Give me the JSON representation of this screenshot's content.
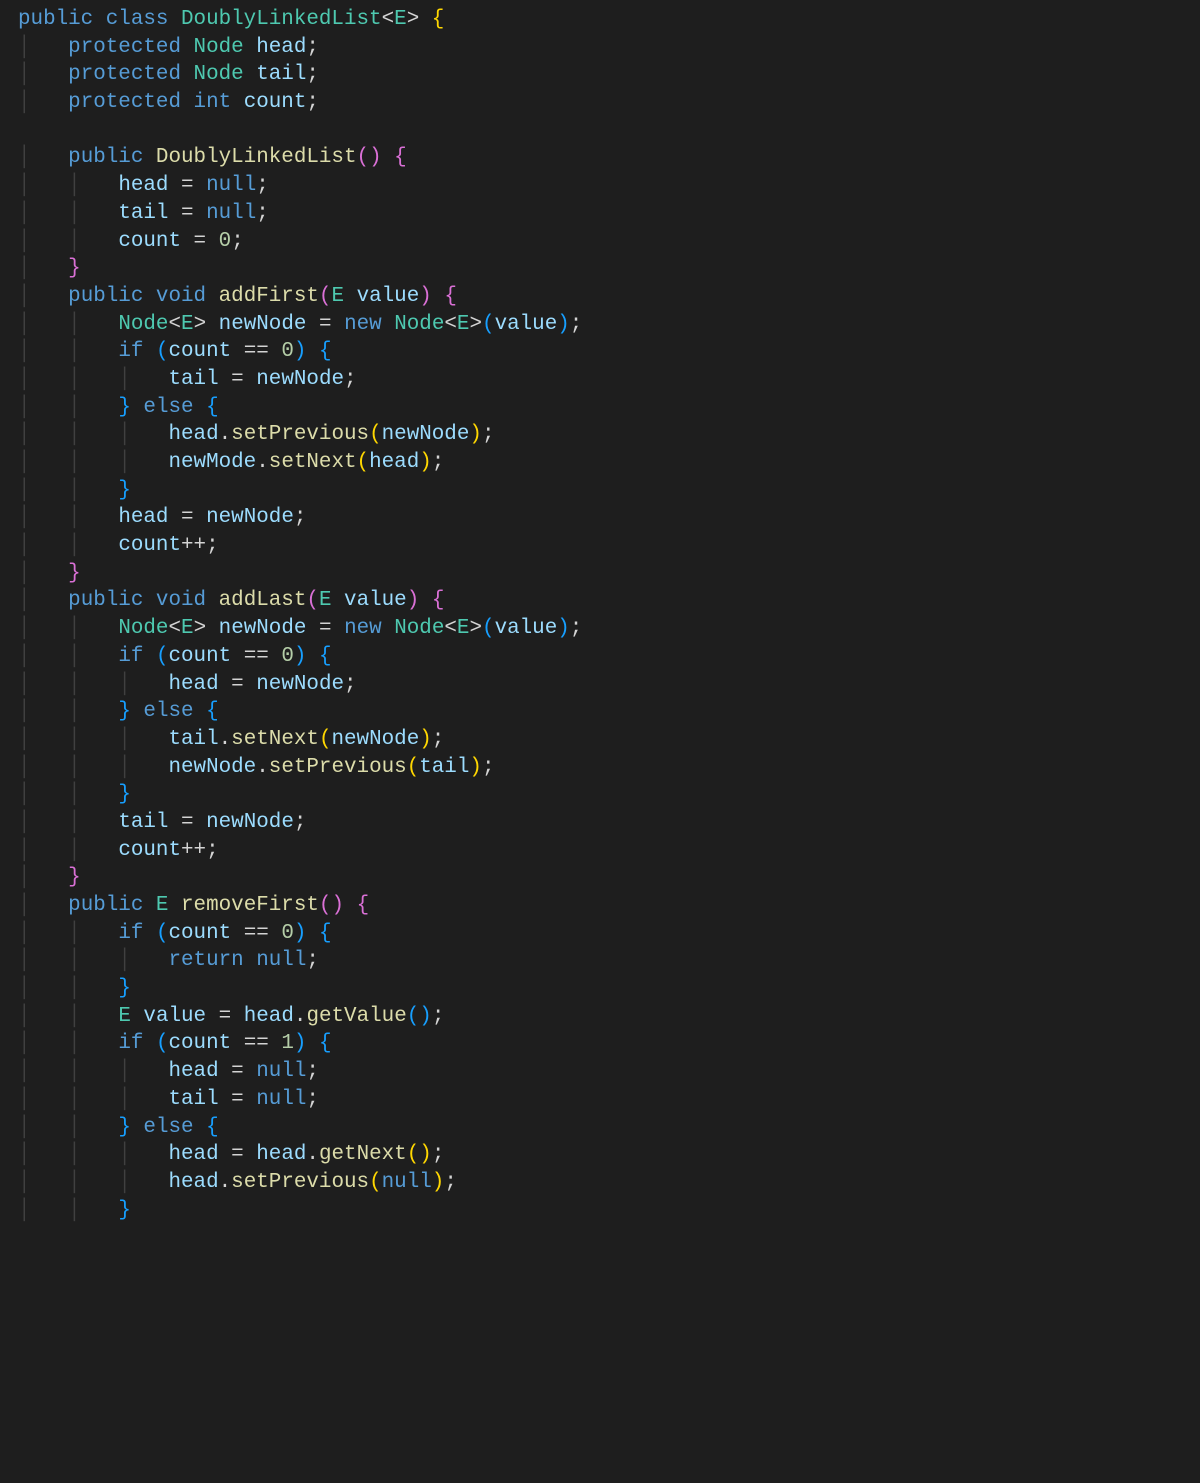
{
  "code": {
    "tokens": [
      [
        [
          "kw",
          "public"
        ],
        [
          "",
          ""
        ],
        [
          "kw",
          "class"
        ],
        [
          "",
          ""
        ],
        [
          "type",
          "DoublyLinkedList"
        ],
        [
          "op",
          "<"
        ],
        [
          "typeparam",
          "E"
        ],
        [
          "op",
          ">"
        ],
        [
          "",
          ""
        ],
        [
          "brace",
          "{"
        ]
      ],
      [
        [
          "",
          "    "
        ],
        [
          "kw",
          "protected"
        ],
        [
          "",
          ""
        ],
        [
          "type",
          "Node"
        ],
        [
          "",
          ""
        ],
        [
          "field",
          "head"
        ],
        [
          "punc",
          ";"
        ]
      ],
      [
        [
          "",
          "    "
        ],
        [
          "kw",
          "protected"
        ],
        [
          "",
          ""
        ],
        [
          "type",
          "Node"
        ],
        [
          "",
          ""
        ],
        [
          "field",
          "tail"
        ],
        [
          "punc",
          ";"
        ]
      ],
      [
        [
          "",
          "    "
        ],
        [
          "kw",
          "protected"
        ],
        [
          "",
          ""
        ],
        [
          "kw",
          "int"
        ],
        [
          "",
          ""
        ],
        [
          "field",
          "count"
        ],
        [
          "punc",
          ";"
        ]
      ],
      [
        [
          "",
          ""
        ]
      ],
      [
        [
          "",
          "    "
        ],
        [
          "kw",
          "public"
        ],
        [
          "",
          ""
        ],
        [
          "fn",
          "DoublyLinkedList"
        ],
        [
          "paren2",
          "("
        ],
        [
          "paren2",
          ")"
        ],
        [
          "",
          ""
        ],
        [
          "brace2",
          "{"
        ]
      ],
      [
        [
          "",
          "        "
        ],
        [
          "field",
          "head"
        ],
        [
          "",
          ""
        ],
        [
          "op",
          "="
        ],
        [
          "",
          ""
        ],
        [
          "kw",
          "null"
        ],
        [
          "punc",
          ";"
        ]
      ],
      [
        [
          "",
          "        "
        ],
        [
          "field",
          "tail"
        ],
        [
          "",
          ""
        ],
        [
          "op",
          "="
        ],
        [
          "",
          ""
        ],
        [
          "kw",
          "null"
        ],
        [
          "punc",
          ";"
        ]
      ],
      [
        [
          "",
          "        "
        ],
        [
          "field",
          "count"
        ],
        [
          "",
          ""
        ],
        [
          "op",
          "="
        ],
        [
          "",
          ""
        ],
        [
          "num",
          "0"
        ],
        [
          "punc",
          ";"
        ]
      ],
      [
        [
          "",
          "    "
        ],
        [
          "brace2",
          "}"
        ]
      ],
      [
        [
          "",
          "    "
        ],
        [
          "kw",
          "public"
        ],
        [
          "",
          ""
        ],
        [
          "kw",
          "void"
        ],
        [
          "",
          ""
        ],
        [
          "fn",
          "addFirst"
        ],
        [
          "paren2",
          "("
        ],
        [
          "type",
          "E"
        ],
        [
          "",
          ""
        ],
        [
          "var",
          "value"
        ],
        [
          "paren2",
          ")"
        ],
        [
          "",
          ""
        ],
        [
          "brace2",
          "{"
        ]
      ],
      [
        [
          "",
          "        "
        ],
        [
          "type",
          "Node"
        ],
        [
          "op",
          "<"
        ],
        [
          "type",
          "E"
        ],
        [
          "op",
          ">"
        ],
        [
          "",
          ""
        ],
        [
          "var",
          "newNode"
        ],
        [
          "",
          ""
        ],
        [
          "op",
          "="
        ],
        [
          "",
          ""
        ],
        [
          "kw",
          "new"
        ],
        [
          "",
          ""
        ],
        [
          "type",
          "Node"
        ],
        [
          "op",
          "<"
        ],
        [
          "type",
          "E"
        ],
        [
          "op",
          ">"
        ],
        [
          "paren3",
          "("
        ],
        [
          "var",
          "value"
        ],
        [
          "paren3",
          ")"
        ],
        [
          "punc",
          ";"
        ]
      ],
      [
        [
          "",
          "        "
        ],
        [
          "kw",
          "if"
        ],
        [
          "",
          ""
        ],
        [
          "paren3",
          "("
        ],
        [
          "field",
          "count"
        ],
        [
          "",
          ""
        ],
        [
          "op",
          "=="
        ],
        [
          "",
          ""
        ],
        [
          "num",
          "0"
        ],
        [
          "paren3",
          ")"
        ],
        [
          "",
          ""
        ],
        [
          "brace3",
          "{"
        ]
      ],
      [
        [
          "",
          "            "
        ],
        [
          "field",
          "tail"
        ],
        [
          "",
          ""
        ],
        [
          "op",
          "="
        ],
        [
          "",
          ""
        ],
        [
          "var",
          "newNode"
        ],
        [
          "punc",
          ";"
        ]
      ],
      [
        [
          "",
          "        "
        ],
        [
          "brace3",
          "}"
        ],
        [
          "",
          ""
        ],
        [
          "kw",
          "else"
        ],
        [
          "",
          ""
        ],
        [
          "brace3",
          "{"
        ]
      ],
      [
        [
          "",
          "            "
        ],
        [
          "field",
          "head"
        ],
        [
          "punc",
          "."
        ],
        [
          "fn",
          "setPrevious"
        ],
        [
          "paren",
          "("
        ],
        [
          "var",
          "newNode"
        ],
        [
          "paren",
          ")"
        ],
        [
          "punc",
          ";"
        ]
      ],
      [
        [
          "",
          "            "
        ],
        [
          "var",
          "newMode"
        ],
        [
          "punc",
          "."
        ],
        [
          "fn",
          "setNext"
        ],
        [
          "paren",
          "("
        ],
        [
          "field",
          "head"
        ],
        [
          "paren",
          ")"
        ],
        [
          "punc",
          ";"
        ]
      ],
      [
        [
          "",
          "        "
        ],
        [
          "brace3",
          "}"
        ]
      ],
      [
        [
          "",
          "        "
        ],
        [
          "field",
          "head"
        ],
        [
          "",
          ""
        ],
        [
          "op",
          "="
        ],
        [
          "",
          ""
        ],
        [
          "var",
          "newNode"
        ],
        [
          "punc",
          ";"
        ]
      ],
      [
        [
          "",
          "        "
        ],
        [
          "field",
          "count"
        ],
        [
          "op",
          "++"
        ],
        [
          "punc",
          ";"
        ]
      ],
      [
        [
          "",
          "    "
        ],
        [
          "brace2",
          "}"
        ]
      ],
      [
        [
          "",
          "    "
        ],
        [
          "kw",
          "public"
        ],
        [
          "",
          ""
        ],
        [
          "kw",
          "void"
        ],
        [
          "",
          ""
        ],
        [
          "fn",
          "addLast"
        ],
        [
          "paren2",
          "("
        ],
        [
          "type",
          "E"
        ],
        [
          "",
          ""
        ],
        [
          "var",
          "value"
        ],
        [
          "paren2",
          ")"
        ],
        [
          "",
          ""
        ],
        [
          "brace2",
          "{"
        ]
      ],
      [
        [
          "",
          "        "
        ],
        [
          "type",
          "Node"
        ],
        [
          "op",
          "<"
        ],
        [
          "type",
          "E"
        ],
        [
          "op",
          ">"
        ],
        [
          "",
          ""
        ],
        [
          "var",
          "newNode"
        ],
        [
          "",
          ""
        ],
        [
          "op",
          "="
        ],
        [
          "",
          ""
        ],
        [
          "kw",
          "new"
        ],
        [
          "",
          ""
        ],
        [
          "type",
          "Node"
        ],
        [
          "op",
          "<"
        ],
        [
          "type",
          "E"
        ],
        [
          "op",
          ">"
        ],
        [
          "paren3",
          "("
        ],
        [
          "var",
          "value"
        ],
        [
          "paren3",
          ")"
        ],
        [
          "punc",
          ";"
        ]
      ],
      [
        [
          "",
          "        "
        ],
        [
          "kw",
          "if"
        ],
        [
          "",
          ""
        ],
        [
          "paren3",
          "("
        ],
        [
          "field",
          "count"
        ],
        [
          "",
          ""
        ],
        [
          "op",
          "=="
        ],
        [
          "",
          ""
        ],
        [
          "num",
          "0"
        ],
        [
          "paren3",
          ")"
        ],
        [
          "",
          ""
        ],
        [
          "brace3",
          "{"
        ]
      ],
      [
        [
          "",
          "            "
        ],
        [
          "field",
          "head"
        ],
        [
          "",
          ""
        ],
        [
          "op",
          "="
        ],
        [
          "",
          ""
        ],
        [
          "var",
          "newNode"
        ],
        [
          "punc",
          ";"
        ]
      ],
      [
        [
          "",
          "        "
        ],
        [
          "brace3",
          "}"
        ],
        [
          "",
          ""
        ],
        [
          "kw",
          "else"
        ],
        [
          "",
          ""
        ],
        [
          "brace3",
          "{"
        ]
      ],
      [
        [
          "",
          "            "
        ],
        [
          "field",
          "tail"
        ],
        [
          "punc",
          "."
        ],
        [
          "fn",
          "setNext"
        ],
        [
          "paren",
          "("
        ],
        [
          "var",
          "newNode"
        ],
        [
          "paren",
          ")"
        ],
        [
          "punc",
          ";"
        ]
      ],
      [
        [
          "",
          "            "
        ],
        [
          "var",
          "newNode"
        ],
        [
          "punc",
          "."
        ],
        [
          "fn",
          "setPrevious"
        ],
        [
          "paren",
          "("
        ],
        [
          "field",
          "tail"
        ],
        [
          "paren",
          ")"
        ],
        [
          "punc",
          ";"
        ]
      ],
      [
        [
          "",
          "        "
        ],
        [
          "brace3",
          "}"
        ]
      ],
      [
        [
          "",
          "        "
        ],
        [
          "field",
          "tail"
        ],
        [
          "",
          ""
        ],
        [
          "op",
          "="
        ],
        [
          "",
          ""
        ],
        [
          "var",
          "newNode"
        ],
        [
          "punc",
          ";"
        ]
      ],
      [
        [
          "",
          "        "
        ],
        [
          "field",
          "count"
        ],
        [
          "op",
          "++"
        ],
        [
          "punc",
          ";"
        ]
      ],
      [
        [
          "",
          "    "
        ],
        [
          "brace2",
          "}"
        ]
      ],
      [
        [
          "",
          "    "
        ],
        [
          "kw",
          "public"
        ],
        [
          "",
          ""
        ],
        [
          "type",
          "E"
        ],
        [
          "",
          ""
        ],
        [
          "fn",
          "removeFirst"
        ],
        [
          "paren2",
          "("
        ],
        [
          "paren2",
          ")"
        ],
        [
          "",
          ""
        ],
        [
          "brace2",
          "{"
        ]
      ],
      [
        [
          "",
          "        "
        ],
        [
          "kw",
          "if"
        ],
        [
          "",
          ""
        ],
        [
          "paren3",
          "("
        ],
        [
          "field",
          "count"
        ],
        [
          "",
          ""
        ],
        [
          "op",
          "=="
        ],
        [
          "",
          ""
        ],
        [
          "num",
          "0"
        ],
        [
          "paren3",
          ")"
        ],
        [
          "",
          ""
        ],
        [
          "brace3",
          "{"
        ]
      ],
      [
        [
          "",
          "            "
        ],
        [
          "kw",
          "return"
        ],
        [
          "",
          ""
        ],
        [
          "kw",
          "null"
        ],
        [
          "punc",
          ";"
        ]
      ],
      [
        [
          "",
          "        "
        ],
        [
          "brace3",
          "}"
        ]
      ],
      [
        [
          "",
          "        "
        ],
        [
          "type",
          "E"
        ],
        [
          "",
          ""
        ],
        [
          "var",
          "value"
        ],
        [
          "",
          ""
        ],
        [
          "op",
          "="
        ],
        [
          "",
          ""
        ],
        [
          "field",
          "head"
        ],
        [
          "punc",
          "."
        ],
        [
          "fn",
          "getValue"
        ],
        [
          "paren3",
          "("
        ],
        [
          "paren3",
          ")"
        ],
        [
          "punc",
          ";"
        ]
      ],
      [
        [
          "",
          "        "
        ],
        [
          "kw",
          "if"
        ],
        [
          "",
          ""
        ],
        [
          "paren3",
          "("
        ],
        [
          "field",
          "count"
        ],
        [
          "",
          ""
        ],
        [
          "op",
          "=="
        ],
        [
          "",
          ""
        ],
        [
          "num",
          "1"
        ],
        [
          "paren3",
          ")"
        ],
        [
          "",
          ""
        ],
        [
          "brace3",
          "{"
        ]
      ],
      [
        [
          "",
          "            "
        ],
        [
          "field",
          "head"
        ],
        [
          "",
          ""
        ],
        [
          "op",
          "="
        ],
        [
          "",
          ""
        ],
        [
          "kw",
          "null"
        ],
        [
          "punc",
          ";"
        ]
      ],
      [
        [
          "",
          "            "
        ],
        [
          "field",
          "tail"
        ],
        [
          "",
          ""
        ],
        [
          "op",
          "="
        ],
        [
          "",
          ""
        ],
        [
          "kw",
          "null"
        ],
        [
          "punc",
          ";"
        ]
      ],
      [
        [
          "",
          "        "
        ],
        [
          "brace3",
          "}"
        ],
        [
          "",
          ""
        ],
        [
          "kw",
          "else"
        ],
        [
          "",
          ""
        ],
        [
          "brace3",
          "{"
        ]
      ],
      [
        [
          "",
          "            "
        ],
        [
          "field",
          "head"
        ],
        [
          "",
          ""
        ],
        [
          "op",
          "="
        ],
        [
          "",
          ""
        ],
        [
          "field",
          "head"
        ],
        [
          "punc",
          "."
        ],
        [
          "fn",
          "getNext"
        ],
        [
          "paren",
          "("
        ],
        [
          "paren",
          ")"
        ],
        [
          "punc",
          ";"
        ]
      ],
      [
        [
          "",
          "            "
        ],
        [
          "field",
          "head"
        ],
        [
          "punc",
          "."
        ],
        [
          "fn",
          "setPrevious"
        ],
        [
          "paren",
          "("
        ],
        [
          "kw",
          "null"
        ],
        [
          "paren",
          ")"
        ],
        [
          "punc",
          ";"
        ]
      ],
      [
        [
          "",
          "        "
        ],
        [
          "brace3",
          "}"
        ]
      ]
    ]
  }
}
